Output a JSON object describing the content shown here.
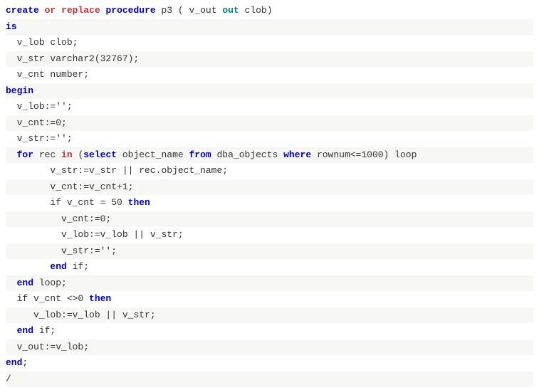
{
  "code": {
    "lines": [
      {
        "indent": 0,
        "frags": [
          {
            "cls": "kw-blue",
            "t": "create"
          },
          {
            "cls": "plain",
            "t": " "
          },
          {
            "cls": "kw-red",
            "t": "or"
          },
          {
            "cls": "plain",
            "t": " "
          },
          {
            "cls": "kw-red",
            "t": "replace"
          },
          {
            "cls": "plain",
            "t": " "
          },
          {
            "cls": "kw-blue",
            "t": "procedure"
          },
          {
            "cls": "plain",
            "t": " p3 ( v_out "
          },
          {
            "cls": "kw-teal",
            "t": "out"
          },
          {
            "cls": "plain",
            "t": " clob)"
          }
        ]
      },
      {
        "indent": 0,
        "frags": [
          {
            "cls": "kw-blue",
            "t": "is"
          }
        ]
      },
      {
        "indent": 2,
        "frags": [
          {
            "cls": "plain",
            "t": "v_lob clob;"
          }
        ]
      },
      {
        "indent": 2,
        "frags": [
          {
            "cls": "plain",
            "t": "v_str varchar2(32767);"
          }
        ]
      },
      {
        "indent": 2,
        "frags": [
          {
            "cls": "plain",
            "t": "v_cnt number;"
          }
        ]
      },
      {
        "indent": 0,
        "frags": [
          {
            "cls": "kw-blue",
            "t": "begin"
          }
        ]
      },
      {
        "indent": 2,
        "frags": [
          {
            "cls": "plain",
            "t": "v_lob:='';"
          }
        ]
      },
      {
        "indent": 2,
        "frags": [
          {
            "cls": "plain",
            "t": "v_cnt:=0;"
          }
        ]
      },
      {
        "indent": 2,
        "frags": [
          {
            "cls": "plain",
            "t": "v_str:='';"
          }
        ]
      },
      {
        "indent": 2,
        "frags": [
          {
            "cls": "kw-blue",
            "t": "for"
          },
          {
            "cls": "plain",
            "t": " rec "
          },
          {
            "cls": "kw-red",
            "t": "in"
          },
          {
            "cls": "plain",
            "t": " ("
          },
          {
            "cls": "kw-blue",
            "t": "select"
          },
          {
            "cls": "plain",
            "t": " object_name "
          },
          {
            "cls": "kw-blue",
            "t": "from"
          },
          {
            "cls": "plain",
            "t": " dba_objects "
          },
          {
            "cls": "kw-blue",
            "t": "where"
          },
          {
            "cls": "plain",
            "t": " rownum<=1000) loop"
          }
        ]
      },
      {
        "indent": 8,
        "frags": [
          {
            "cls": "plain",
            "t": "v_str:=v_str || rec.object_name;"
          }
        ]
      },
      {
        "indent": 8,
        "frags": [
          {
            "cls": "plain",
            "t": "v_cnt:=v_cnt+1;"
          }
        ]
      },
      {
        "indent": 8,
        "frags": [
          {
            "cls": "plain",
            "t": "if v_cnt = 50 "
          },
          {
            "cls": "kw-blue",
            "t": "then"
          }
        ]
      },
      {
        "indent": 10,
        "frags": [
          {
            "cls": "plain",
            "t": "v_cnt:=0;"
          }
        ]
      },
      {
        "indent": 10,
        "frags": [
          {
            "cls": "plain",
            "t": "v_lob:=v_lob || v_str;"
          }
        ]
      },
      {
        "indent": 10,
        "frags": [
          {
            "cls": "plain",
            "t": "v_str:='';"
          }
        ]
      },
      {
        "indent": 8,
        "frags": [
          {
            "cls": "kw-blue",
            "t": "end"
          },
          {
            "cls": "plain",
            "t": " if;"
          }
        ]
      },
      {
        "indent": 2,
        "frags": [
          {
            "cls": "kw-blue",
            "t": "end"
          },
          {
            "cls": "plain",
            "t": " loop;"
          }
        ]
      },
      {
        "indent": 2,
        "frags": [
          {
            "cls": "plain",
            "t": "if v_cnt <>0 "
          },
          {
            "cls": "kw-blue",
            "t": "then"
          }
        ]
      },
      {
        "indent": 5,
        "frags": [
          {
            "cls": "plain",
            "t": "v_lob:=v_lob || v_str;"
          }
        ]
      },
      {
        "indent": 2,
        "frags": [
          {
            "cls": "kw-blue",
            "t": "end"
          },
          {
            "cls": "plain",
            "t": " if;"
          }
        ]
      },
      {
        "indent": 2,
        "frags": [
          {
            "cls": "plain",
            "t": "v_out:=v_lob;"
          }
        ]
      },
      {
        "indent": 0,
        "frags": [
          {
            "cls": "kw-blue",
            "t": "end"
          },
          {
            "cls": "plain",
            "t": ";"
          }
        ]
      },
      {
        "indent": 0,
        "frags": [
          {
            "cls": "plain",
            "t": "/"
          }
        ]
      }
    ]
  }
}
